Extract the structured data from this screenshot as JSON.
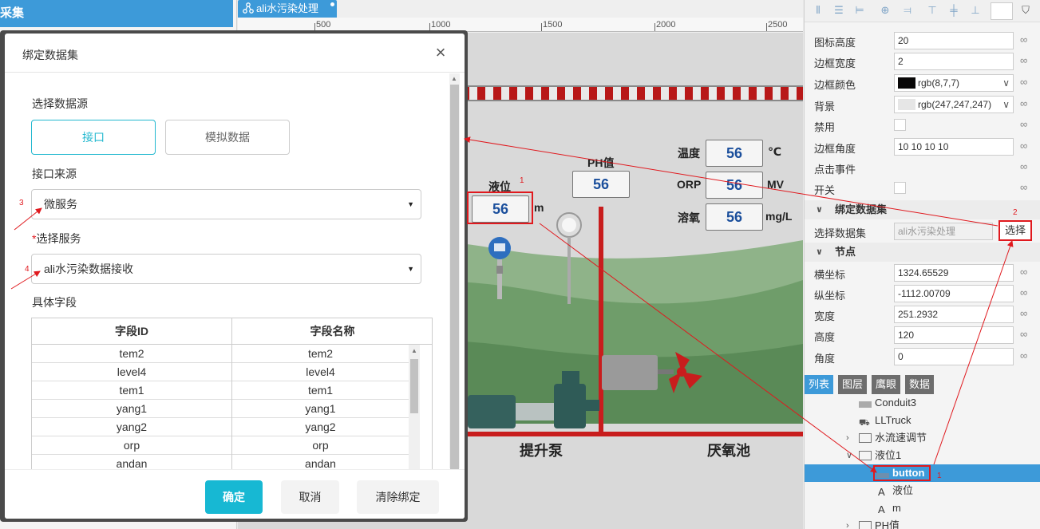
{
  "left_panel": {
    "header": "采集"
  },
  "canvas": {
    "tab_title": "ali水污染处理",
    "ruler_labels": [
      "500",
      "1000",
      "1500",
      "2000",
      "2500"
    ],
    "labels": {
      "level": "液位",
      "level_unit": "m",
      "ph": "PH值",
      "temp": "温度",
      "temp_unit": "℃",
      "orp": "ORP",
      "orp_unit": "MV",
      "oxygen": "溶氧",
      "oxygen_unit": "mg/L",
      "pump": "提升泵",
      "anoxic_tank": "厌氧池"
    },
    "values": {
      "level": "56",
      "ph": "56",
      "temp": "56",
      "orp": "56",
      "oxygen": "56"
    }
  },
  "modal": {
    "title": "绑定数据集",
    "close_symbol": "×",
    "source_label": "选择数据源",
    "source_options": [
      "接口",
      "模拟数据"
    ],
    "interface_source_label": "接口来源",
    "interface_source_value": "微服务",
    "service_required": "*",
    "service_label": "选择服务",
    "service_value": "ali水污染数据接收",
    "fields_label": "具体字段",
    "table_headers": [
      "字段ID",
      "字段名称"
    ],
    "rows": [
      [
        "tem2",
        "tem2"
      ],
      [
        "level4",
        "level4"
      ],
      [
        "tem1",
        "tem1"
      ],
      [
        "yang1",
        "yang1"
      ],
      [
        "yang2",
        "yang2"
      ],
      [
        "orp",
        "orp"
      ],
      [
        "andan",
        "andan"
      ]
    ],
    "buttons": {
      "confirm": "确定",
      "cancel": "取消",
      "clear": "清除绑定"
    }
  },
  "properties": {
    "rows": [
      {
        "label": "图标高度",
        "value": "20"
      },
      {
        "label": "边框宽度",
        "value": "2"
      },
      {
        "label": "边框颜色",
        "value": "rgb(8,7,7)",
        "color": "#080707"
      },
      {
        "label": "背景",
        "value": "rgb(247,247,247)",
        "color": "#f7f7f7"
      },
      {
        "label": "禁用"
      },
      {
        "label": "边框角度",
        "value": "10 10 10 10"
      },
      {
        "label": "点击事件"
      },
      {
        "label": "开关"
      }
    ],
    "dataset_section": "绑定数据集",
    "dataset_label": "选择数据集",
    "dataset_value": "ali水污染处理",
    "select_button": "选择",
    "node_section": "节点",
    "node_rows": [
      {
        "label": "横坐标",
        "value": "1324.65529"
      },
      {
        "label": "纵坐标",
        "value": "-1112.00709"
      },
      {
        "label": "宽度",
        "value": "251.2932"
      },
      {
        "label": "高度",
        "value": "120"
      },
      {
        "label": "角度",
        "value": "0"
      }
    ]
  },
  "bottom_tabs": [
    "列表",
    "图层",
    "鹰眼",
    "数据"
  ],
  "tree": [
    {
      "label": "Conduit3"
    },
    {
      "label": "LLTruck"
    },
    {
      "label": "水流速调节"
    },
    {
      "label": "液位1"
    },
    {
      "label": "button"
    },
    {
      "label": "液位"
    },
    {
      "label": "m"
    },
    {
      "label": "PH值"
    }
  ],
  "annotations": {
    "n1": "1",
    "n2": "2",
    "n3": "3",
    "n4": "4"
  },
  "colors": {
    "accent": "#3d9ad9",
    "primary_button": "#17b8d3",
    "annotation_red": "#e0191e",
    "pipe_red": "#c81d1d"
  }
}
